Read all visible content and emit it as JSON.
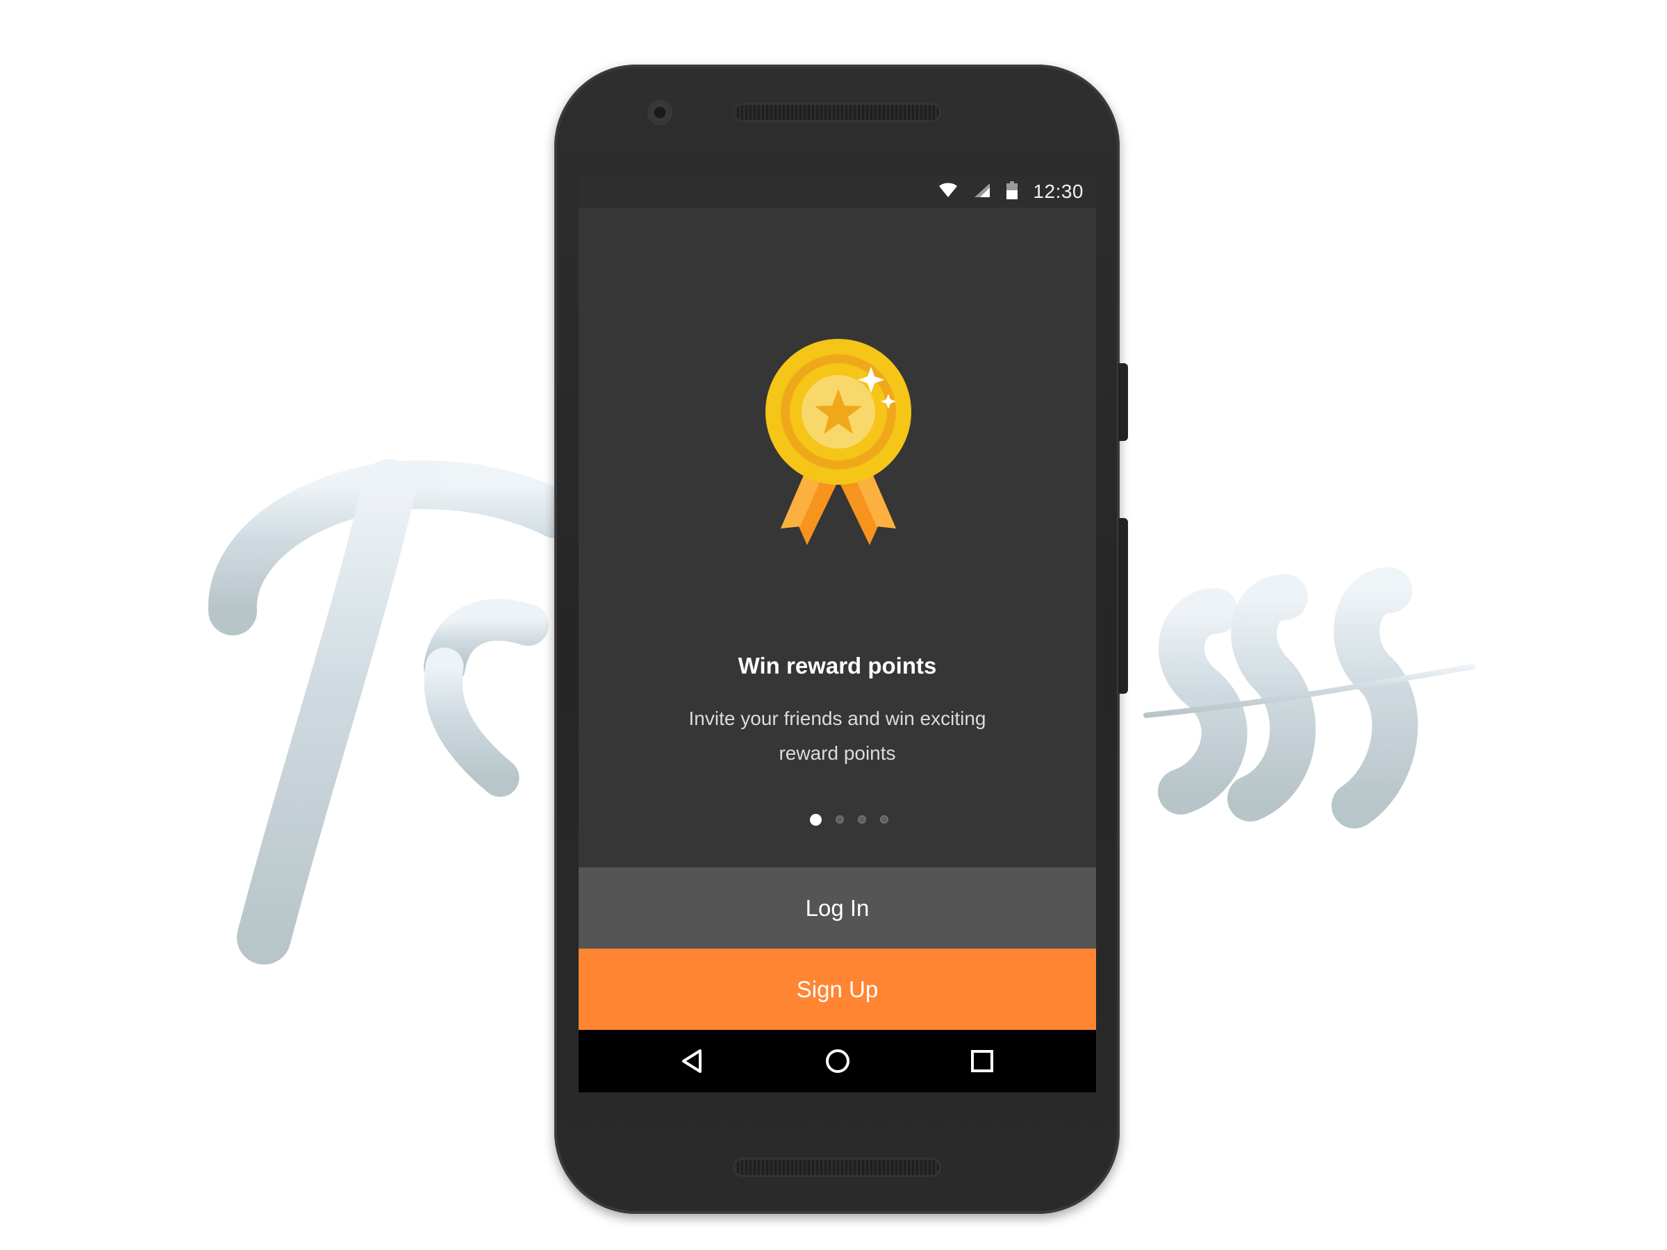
{
  "background": {
    "logo_text": "Trapass",
    "colors": {
      "page": "#ffffff",
      "script_light": "#e7eef4",
      "script_mid": "#b9c9d2"
    }
  },
  "status_bar": {
    "time": "12:30",
    "icons": [
      "wifi-icon",
      "signal-icon",
      "battery-icon"
    ]
  },
  "onboarding": {
    "illustration": "medal-ribbon-icon",
    "title": "Win reward points",
    "description": "Invite your friends and win exciting reward points",
    "pager": {
      "current": 1,
      "total": 4
    }
  },
  "actions": {
    "login_label": "Log In",
    "signup_label": "Sign Up"
  },
  "nav_bar": {
    "icons": [
      "back-icon",
      "home-icon",
      "recents-icon"
    ]
  },
  "colors": {
    "screen_bg": "#363636",
    "login_bg": "#555555",
    "signup_bg": "#ff8533",
    "medal_gold": "#f5c518",
    "ribbon_orange": "#f7941d"
  }
}
